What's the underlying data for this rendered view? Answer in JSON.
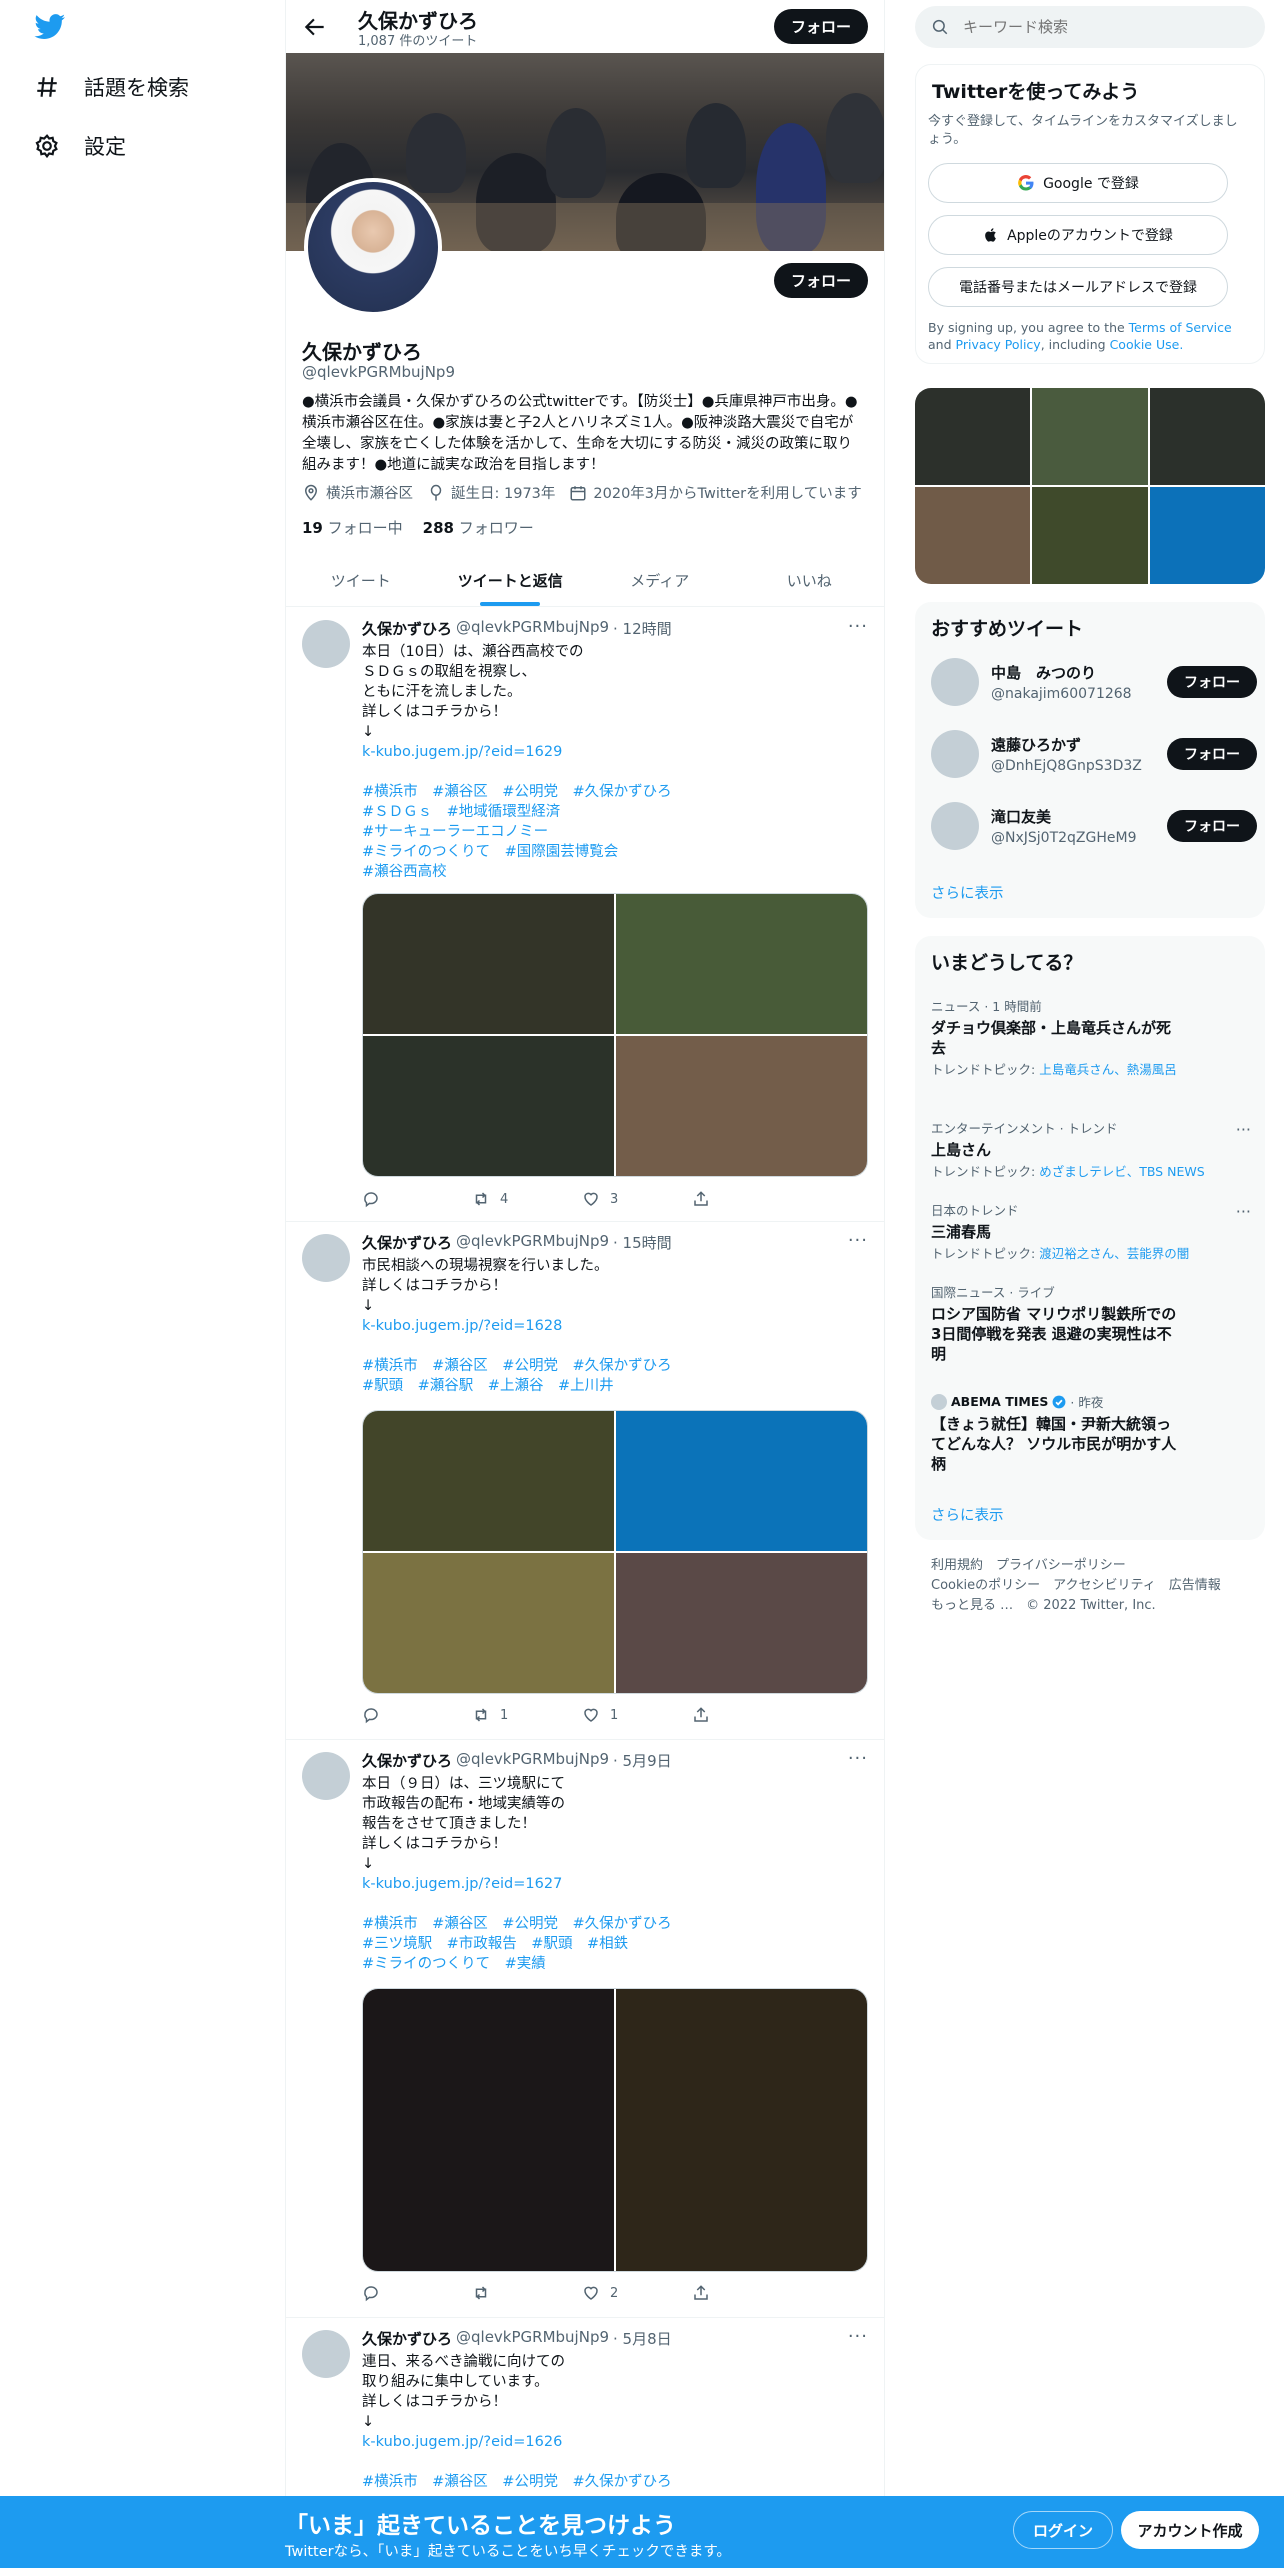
{
  "nav": {
    "explore_label": "話題を検索",
    "settings_label": "設定"
  },
  "header": {
    "name": "久保かずひろ",
    "tweet_count": "1,087 件のツイート",
    "follow_label": "フォロー"
  },
  "profile": {
    "name": "久保かずひろ",
    "handle": "@qlevkPGRMbujNp9",
    "follow_label": "フォロー",
    "bio": "●横浜市会議員・久保かずひろの公式twitterです。【防災士】●兵庫県神戸市出身。●横浜市瀬谷区在住。●家族は妻と子2人とハリネズミ1人。●阪神淡路大震災で自宅が全壊し、家族を亡くした体験を活かして、生命を大切にする防災・減災の政策に取り組みます！●地道に誠実な政治を目指します！",
    "location": "横浜市瀬谷区",
    "birthday": "誕生日: 1973年",
    "joined": "2020年3月からTwitterを利用しています",
    "following_count": "19",
    "following_label": "フォロー中",
    "followers_count": "288",
    "followers_label": "フォロワー"
  },
  "tabs": [
    {
      "label": "ツイート"
    },
    {
      "label": "ツイートと返信",
      "active": true
    },
    {
      "label": "メディア"
    },
    {
      "label": "いいね"
    }
  ],
  "tweets": [
    {
      "name": "久保かずひろ",
      "handle": "@qlevkPGRMbujNp9",
      "time": "· 12時間",
      "text": "本日（10日）は、瀬谷西高校での\nＳＤＧｓの取組を視察し、\nともに汗を流しました。\n詳しくはコチラから！\n↓",
      "link": "k-kubo.jugem.jp/?eid=1629",
      "tags": "#横浜市　#瀬谷区　#公明党　#久保かずひろ\n#ＳＤＧｓ　#地域循環型経済\n#サーキューラーエコノミー\n#ミライのつくりて　#国際園芸博覧会\n#瀬谷西高校",
      "media_colors": [
        "#333428",
        "#485b38",
        "#2b3229",
        "#735d4a"
      ],
      "retweets": "4",
      "likes": "3"
    },
    {
      "name": "久保かずひろ",
      "handle": "@qlevkPGRMbujNp9",
      "time": "· 15時間",
      "text": "市民相談への現場視察を行いました。\n詳しくはコチラから！\n↓",
      "link": "k-kubo.jugem.jp/?eid=1628",
      "tags": "#横浜市　#瀬谷区　#公明党　#久保かずひろ\n#駅頭　#瀬谷駅　#上瀬谷　#上川井",
      "media_colors": [
        "#424529",
        "#0b73b9",
        "#7b7242",
        "#5a4947"
      ],
      "retweets": "1",
      "likes": "1"
    },
    {
      "name": "久保かずひろ",
      "handle": "@qlevkPGRMbujNp9",
      "time": "· 5月9日",
      "text": "本日（９日）は、三ツ境駅にて\n市政報告の配布・地域実績等の\n報告をさせて頂きました！\n詳しくはコチラから！\n↓",
      "link": "k-kubo.jugem.jp/?eid=1627",
      "tags": "#横浜市　#瀬谷区　#公明党　#久保かずひろ\n#三ツ境駅　#市政報告　#駅頭　#相鉄\n#ミライのつくりて　#実績",
      "media_colors": [
        "#1b1718",
        "#2e2619"
      ],
      "retweets": "",
      "likes": "2"
    },
    {
      "name": "久保かずひろ",
      "handle": "@qlevkPGRMbujNp9",
      "time": "· 5月8日",
      "text": "連日、来るべき論戦に向けての\n取り組みに集中しています。\n詳しくはコチラから！\n↓",
      "link": "k-kubo.jugem.jp/?eid=1626",
      "tags": "#横浜市　#瀬谷区　#公明党　#久保かずひろ"
    }
  ],
  "right": {
    "search_placeholder": "キーワード検索",
    "signup": {
      "title": "Twitterを使ってみよう",
      "subtitle": "今すぐ登録して、タイムラインをカスタマイズしましょう。",
      "google": "Google で登録",
      "apple": "Appleのアカウントで登録",
      "phone": "電話番号またはメールアドレスで登録",
      "terms_prefix": "By signing up, you agree to the",
      "terms": "Terms of Service",
      "and": "and",
      "privacy": "Privacy Policy",
      "including": ", including",
      "cookie": "Cookie Use."
    },
    "media_colors": [
      "#2c302b",
      "#4a5b3e",
      "#2b302b",
      "#705b48",
      "#3f4a2b",
      "#0c71b9"
    ],
    "recommend": {
      "title": "おすすめツイート",
      "users": [
        {
          "name": "中島　みつのり",
          "handle": "@nakajim60071268",
          "follow": "フォロー"
        },
        {
          "name": "遠藤ひろかず",
          "handle": "@DnhEjQ8GnpS3D3Z",
          "follow": "フォロー"
        },
        {
          "name": "滝口友美",
          "handle": "@NxJSj0T2qZGHeM9",
          "follow": "フォロー"
        }
      ],
      "more": "さらに表示"
    },
    "trends": {
      "title": "いまどうしてる？",
      "items": [
        {
          "cat": "ニュース · 1 時間前",
          "title": "ダチョウ倶楽部・上島竜兵さんが死去",
          "sub_prefix": "トレンドトピック: ",
          "sub_links": "上島竜兵さん、熱湯風呂"
        },
        {
          "cat": "エンターテインメント · トレンド",
          "title": "上島さん",
          "sub_prefix": "トレンドトピック: ",
          "sub_links": "めざましテレビ、TBS NEWS"
        },
        {
          "cat": "日本のトレンド",
          "title": "三浦春馬",
          "sub_prefix": "トレンドトピック: ",
          "sub_links": "渡辺裕之さん、芸能界の闇"
        },
        {
          "cat": "国際ニュース · ライブ",
          "title": "ロシア国防省 マリウポリ製鉄所での3日間停戦を発表 退避の実現性は不明"
        },
        {
          "cat": "ABEMA TIMES",
          "cat_time": "· 昨夜",
          "title": "【きょう就任】韓国・尹新大統領ってどんな人？ ソウル市民が明かす人柄"
        }
      ],
      "more": "さらに表示"
    },
    "footer": {
      "line1": "利用規約　プライバシーポリシー",
      "line2": "Cookieのポリシー　アクセシビリティ　広告情報",
      "line3": "もっと見る …　© 2022 Twitter, Inc."
    }
  },
  "bottom": {
    "title": "「いま」起きていることを見つけよう",
    "subtitle": "Twitterなら、「いま」起きていることをいち早くチェックできます。",
    "login": "ログイン",
    "signup": "アカウント作成"
  },
  "colors": {
    "accent": "#1d9bf0",
    "text": "#0f1419",
    "muted": "#536471"
  }
}
